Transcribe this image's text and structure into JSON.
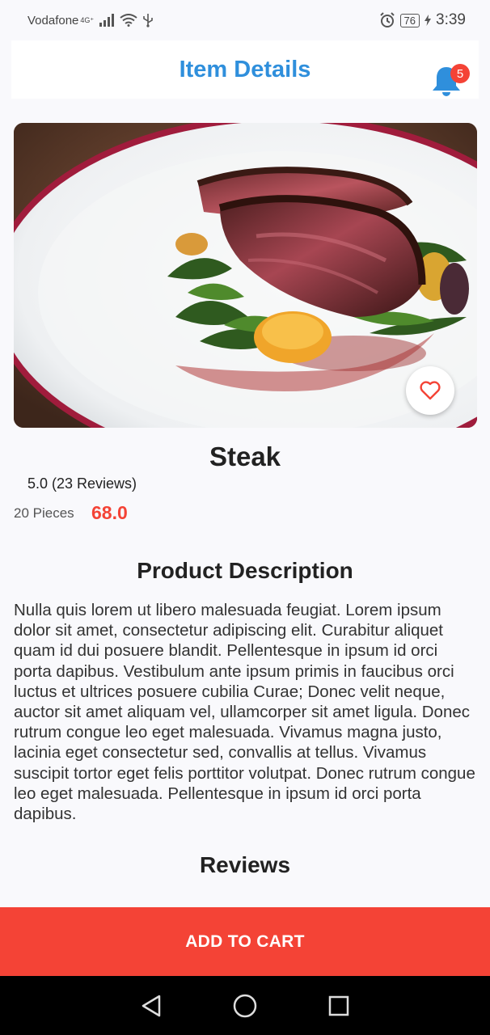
{
  "status_bar": {
    "carrier": "Vodafone",
    "network": "4G⁺",
    "battery": "76",
    "time": "3:39"
  },
  "header": {
    "title": "Item Details",
    "notification_count": "5"
  },
  "product": {
    "name": "Steak",
    "rating_text": "5.0 (23 Reviews)",
    "pieces": "20 Pieces",
    "price": "68.0",
    "description_heading": "Product Description",
    "description": "Nulla quis lorem ut libero malesuada feugiat. Lorem ipsum dolor sit amet, consectetur adipiscing elit. Curabitur aliquet quam id dui posuere blandit. Pellentesque in ipsum id orci porta dapibus. Vestibulum ante ipsum primis in faucibus orci luctus et ultrices posuere cubilia Curae; Donec velit neque, auctor sit amet aliquam vel, ullamcorper sit amet ligula. Donec rutrum congue leo eget malesuada. Vivamus magna justo, lacinia eget consectetur sed, convallis at tellus. Vivamus suscipit tortor eget felis porttitor volutpat. Donec rutrum congue leo eget malesuada. Pellentesque in ipsum id orci porta dapibus.",
    "reviews_heading": "Reviews"
  },
  "actions": {
    "add_to_cart": "ADD TO CART"
  },
  "colors": {
    "accent_blue": "#2f8fdc",
    "accent_red": "#f44336"
  },
  "icons": [
    "signal-icon",
    "wifi-icon",
    "usb-icon",
    "alarm-icon",
    "battery-icon",
    "charging-icon",
    "bell-icon",
    "heart-icon",
    "back-icon",
    "home-icon",
    "recents-icon"
  ]
}
